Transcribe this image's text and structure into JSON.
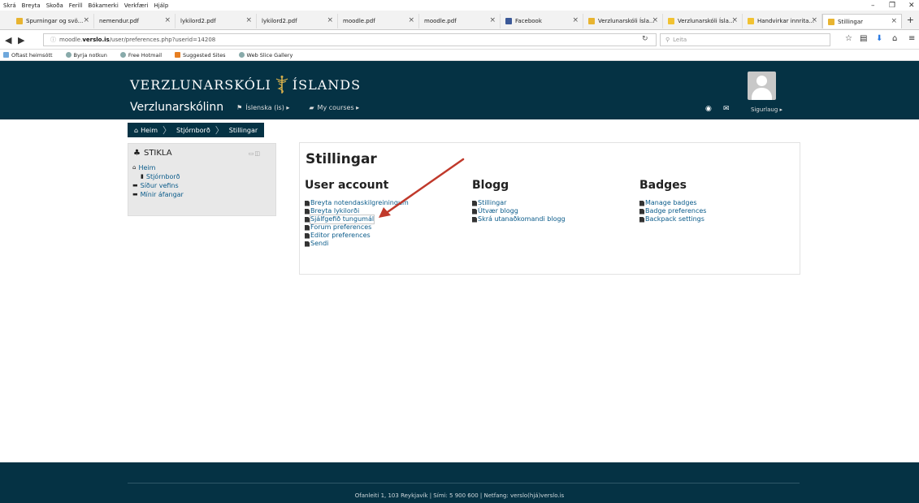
{
  "browser": {
    "menu": [
      "Skrá",
      "Breyta",
      "Skoða",
      "Ferill",
      "Bókamerki",
      "Verkfæri",
      "Hjálp"
    ],
    "window_controls": {
      "minimize": "–",
      "maximize": "❐",
      "close": "✕"
    },
    "tabs": [
      {
        "label": "Spurningar og svö...",
        "favicon": "fav-yellow"
      },
      {
        "label": "nemendur.pdf",
        "favicon": ""
      },
      {
        "label": "lykilord2.pdf",
        "favicon": ""
      },
      {
        "label": "lykilord2.pdf",
        "favicon": ""
      },
      {
        "label": "moodle.pdf",
        "favicon": ""
      },
      {
        "label": "moodle.pdf",
        "favicon": ""
      },
      {
        "label": "Facebook",
        "favicon": "fav-fb"
      },
      {
        "label": "Verzlunarskóli Ísla...",
        "favicon": "fav-yellow"
      },
      {
        "label": "Verzlunarskóli Ísla...",
        "favicon": "fav-yellow2"
      },
      {
        "label": "Handvirkar innrita...",
        "favicon": "fav-yellow2"
      },
      {
        "label": "Stillingar",
        "favicon": "fav-yellow"
      }
    ],
    "url_prefix": "moodle.",
    "url_domain": "verslo.is",
    "url_path": "/user/preferences.php?userid=14208",
    "search_placeholder": "Leita",
    "bookmarks": [
      "Oftast heimsótt",
      "Byrja notkun",
      "Free Hotmail",
      "Suggested Sites",
      "Web Slice Gallery"
    ]
  },
  "header": {
    "logo_left": "VERZLUNARSKÓLI",
    "logo_right": "ÍSLANDS",
    "site_name": "Verzlunarskólinn",
    "language": "Íslenska (is) ▸",
    "my_courses": "My courses ▸",
    "username": "Sigurlaug ▸"
  },
  "breadcrumb": {
    "home": "Heim",
    "dashboard": "Stjórnborð",
    "current": "Stillingar"
  },
  "navblock": {
    "title": "STIKLA",
    "items": {
      "home": "Heim",
      "dashboard": "Stjórnborð",
      "site_pages": "Síður vefins",
      "my_courses": "Mínir áfangar"
    }
  },
  "main": {
    "title": "Stillingar",
    "user_account": {
      "heading": "User account",
      "links": [
        "Breyta notendaskilgreiningum",
        "Breyta lykilorði",
        "Sjálfgefið tungumál",
        "Forum preferences",
        "Editor preferences",
        "Sendi"
      ]
    },
    "blog": {
      "heading": "Blogg",
      "links": [
        "Stillingar",
        "Útvær blogg",
        "Skrá utanaðkomandi blogg"
      ]
    },
    "badges": {
      "heading": "Badges",
      "links": [
        "Manage badges",
        "Badge preferences",
        "Backpack settings"
      ]
    }
  },
  "footer": {
    "text": "Ofanleiti 1, 103 Reykjavík | Sími: 5 900 600 | Netfang: verslo(hjá)verslo.is"
  },
  "colors": {
    "header_bg": "#053244",
    "link": "#0a5b8a",
    "arrow": "#c0392b"
  }
}
